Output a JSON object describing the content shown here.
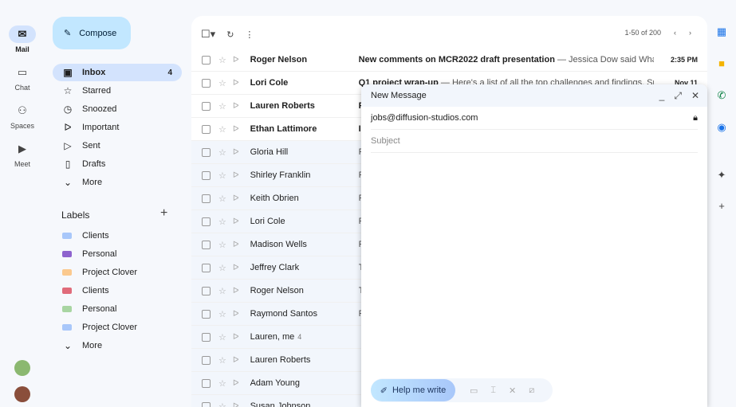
{
  "rail": [
    {
      "label": "Mail",
      "icon": "mail-icon",
      "glyph": "✉",
      "active": true
    },
    {
      "label": "Chat",
      "icon": "chat-icon",
      "glyph": "▭"
    },
    {
      "label": "Spaces",
      "icon": "spaces-icon",
      "glyph": "⚇"
    },
    {
      "label": "Meet",
      "icon": "video-icon",
      "glyph": "▶"
    }
  ],
  "compose": {
    "label": "Compose"
  },
  "nav": [
    {
      "label": "Inbox",
      "glyph": "▣",
      "count": "4",
      "active": true
    },
    {
      "label": "Starred",
      "glyph": "☆"
    },
    {
      "label": "Snoozed",
      "glyph": "◷"
    },
    {
      "label": "Important",
      "glyph": "ᐅ"
    },
    {
      "label": "Sent",
      "glyph": "▷"
    },
    {
      "label": "Drafts",
      "glyph": "▯"
    },
    {
      "label": "More",
      "glyph": "⌄"
    }
  ],
  "labels": {
    "title": "Labels",
    "items": [
      {
        "label": "Clients",
        "color": "#a8c7fa"
      },
      {
        "label": "Personal",
        "color": "#8e63ce"
      },
      {
        "label": "Project Clover",
        "color": "#fbc98e"
      },
      {
        "label": "Clients",
        "color": "#e06b7a"
      },
      {
        "label": "Personal",
        "color": "#a8d5a2"
      },
      {
        "label": "Project Clover",
        "color": "#a8c7fa"
      }
    ],
    "more": "More"
  },
  "pager": {
    "text": "1-50 of 200"
  },
  "emails": [
    {
      "from": "Roger Nelson",
      "subject": "New comments on MCR2022 draft presentation",
      "snippet": " — Jessica Dow said What a...",
      "date": "2:35 PM",
      "unread": true
    },
    {
      "from": "Lori Cole",
      "subject": "Q1 project wrap-up",
      "snippet": " — Here's a list of all the top challenges and findings. Surp...",
      "date": "Nov 11",
      "unread": true
    },
    {
      "from": "Lauren Roberts",
      "subject": "F",
      "snippet": "",
      "date": "",
      "unread": true
    },
    {
      "from": "Ethan Lattimore",
      "subject": "I",
      "snippet": "",
      "date": "",
      "unread": true
    },
    {
      "from": "Gloria Hill",
      "subject": "",
      "snippet": "F",
      "date": ""
    },
    {
      "from": "Shirley Franklin",
      "subject": "",
      "snippet": "F",
      "date": ""
    },
    {
      "from": "Keith Obrien",
      "subject": "",
      "snippet": "F",
      "date": ""
    },
    {
      "from": "Lori Cole",
      "subject": "",
      "snippet": "F",
      "date": ""
    },
    {
      "from": "Madison Wells",
      "subject": "",
      "snippet": "F",
      "date": ""
    },
    {
      "from": "Jeffrey Clark",
      "subject": "",
      "snippet": "T",
      "date": ""
    },
    {
      "from": "Roger Nelson",
      "subject": "",
      "snippet": "T",
      "date": ""
    },
    {
      "from": "Raymond Santos",
      "subject": "",
      "snippet": "F",
      "date": ""
    },
    {
      "from": "Lauren, me",
      "count": "4",
      "subject": "",
      "snippet": "",
      "date": ""
    },
    {
      "from": "Lauren Roberts",
      "subject": "",
      "snippet": "",
      "date": ""
    },
    {
      "from": "Adam Young",
      "subject": "",
      "snippet": "",
      "date": ""
    },
    {
      "from": "Susan Johnson",
      "subject": "",
      "snippet": "",
      "date": ""
    }
  ],
  "compose_window": {
    "title": "New Message",
    "to": "jobs@diffusion-studios.com",
    "subject_placeholder": "Subject",
    "help_me_write": "Help me write"
  },
  "colors": {
    "accent": "#c2e7ff",
    "active_nav": "#d3e3fd"
  }
}
